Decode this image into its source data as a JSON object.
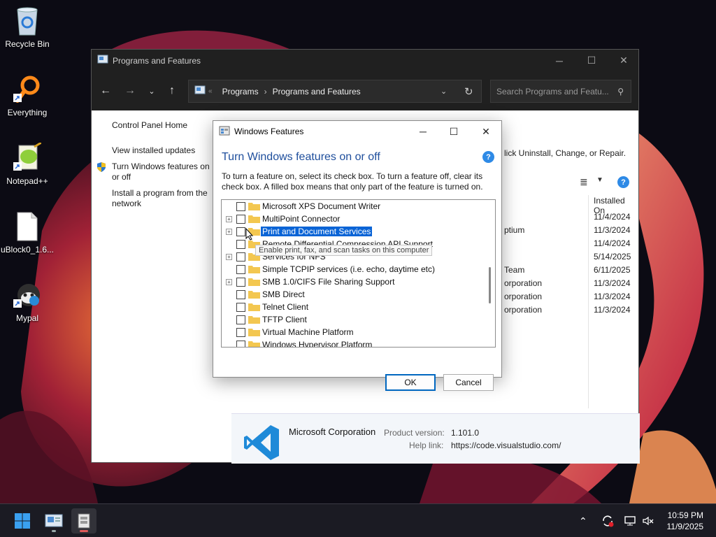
{
  "desktop": {
    "icons": [
      {
        "label": "Recycle Bin"
      },
      {
        "label": "Everything"
      },
      {
        "label": "Notepad++"
      },
      {
        "label": "uBlock0_1.6..."
      },
      {
        "label": "Mypal"
      }
    ]
  },
  "explorer": {
    "title": "Programs and Features",
    "breadcrumb": [
      "Programs",
      "Programs and Features"
    ],
    "search_placeholder": "Search Programs and Featu...",
    "left_pane": {
      "home": "Control Panel Home",
      "updates": "View installed updates",
      "features": "Turn Windows features on or off",
      "install": "Install a program from the network"
    },
    "main_hint": "lick Uninstall, Change, or Repair.",
    "column_installed_on": "Installed On",
    "rows": [
      {
        "publisher": "",
        "date": "11/4/2024"
      },
      {
        "publisher": "ptium",
        "date": "11/3/2024"
      },
      {
        "publisher": "",
        "date": "11/4/2024"
      },
      {
        "publisher": "",
        "date": "5/14/2025"
      },
      {
        "publisher": "Team",
        "date": "6/11/2025"
      },
      {
        "publisher": "orporation",
        "date": "11/3/2024"
      },
      {
        "publisher": "orporation",
        "date": "11/3/2024"
      },
      {
        "publisher": "orporation",
        "date": "11/3/2024"
      }
    ],
    "details": {
      "publisher": "Microsoft Corporation",
      "product_version_label": "Product version:",
      "product_version": "1.101.0",
      "help_link_label": "Help link:",
      "help_link": "https://code.visualstudio.com/"
    }
  },
  "dialog": {
    "title": "Windows Features",
    "heading": "Turn Windows features on or off",
    "description": "To turn a feature on, select its check box. To turn a feature off, clear its check box. A filled box means that only part of the feature is turned on.",
    "features": [
      {
        "label": "Microsoft XPS Document Writer",
        "expandable": false
      },
      {
        "label": "MultiPoint Connector",
        "expandable": true
      },
      {
        "label": "Print and Document Services",
        "expandable": true,
        "selected": true
      },
      {
        "label": "Remote Differential Compression API Support",
        "expandable": false
      },
      {
        "label": "Services for NFS",
        "expandable": true
      },
      {
        "label": "Simple TCPIP services (i.e. echo, daytime etc)",
        "expandable": false
      },
      {
        "label": "SMB 1.0/CIFS File Sharing Support",
        "expandable": true
      },
      {
        "label": "SMB Direct",
        "expandable": false
      },
      {
        "label": "Telnet Client",
        "expandable": false
      },
      {
        "label": "TFTP Client",
        "expandable": false
      },
      {
        "label": "Virtual Machine Platform",
        "expandable": false
      },
      {
        "label": "Windows Hypervisor Platform",
        "expandable": false
      }
    ],
    "tooltip": "Enable print, fax, and scan tasks on this computer",
    "ok": "OK",
    "cancel": "Cancel"
  },
  "taskbar": {
    "time": "10:59 PM",
    "date": "11/9/2025"
  }
}
